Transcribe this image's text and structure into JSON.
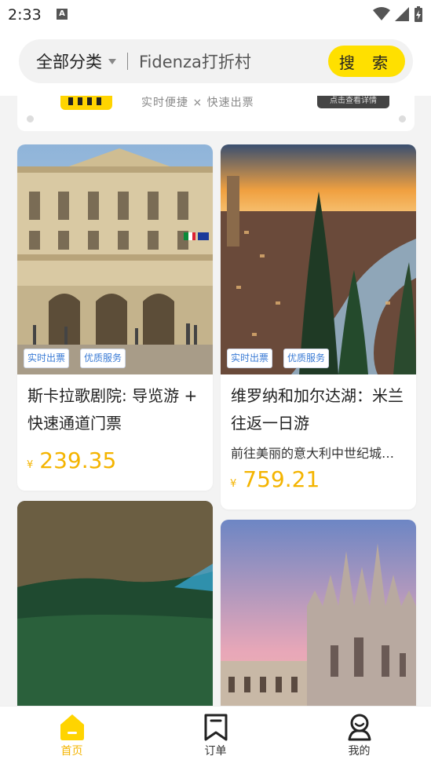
{
  "status_bar": {
    "time": "2:33",
    "notification_letter": "A"
  },
  "search": {
    "category_label": "全部分类",
    "query": "Fidenza打折村",
    "button_label": "搜 索"
  },
  "banner": {
    "subtitle": "实时便捷 × 快速出票",
    "button_label": "点击查看详情"
  },
  "cards": [
    {
      "title": "斯卡拉歌剧院: 导览游 + 快速通道门票",
      "tags": [
        "实时出票",
        "优质服务"
      ],
      "price_symbol": "¥",
      "price": "239.35"
    },
    {
      "title": "维罗纳和加尔达湖：米兰往返一日游",
      "description": "前往美丽的意大利中世纪城市维罗纳",
      "tags": [
        "实时出票",
        "优质服务"
      ],
      "price_symbol": "¥",
      "price": "759.21"
    },
    {
      "title": "",
      "tags": []
    },
    {
      "title": "",
      "tags": []
    }
  ],
  "tab_bar": {
    "items": [
      {
        "label": "首页",
        "active": true
      },
      {
        "label": "订单",
        "active": false
      },
      {
        "label": "我的",
        "active": false
      }
    ]
  },
  "colors": {
    "accent": "#ffe000",
    "price": "#f4b400",
    "tag_text": "#3a7bd5"
  }
}
